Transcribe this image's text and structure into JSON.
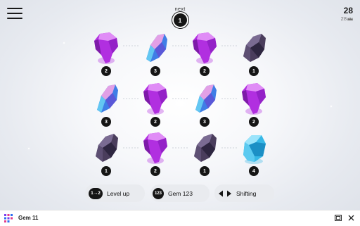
{
  "header": {
    "next_label": "next",
    "next_value": "1",
    "score": "28",
    "best": "28"
  },
  "board": {
    "rows": [
      [
        {
          "gem": "purple",
          "count": "2"
        },
        {
          "gem": "pink-blue",
          "count": "3"
        },
        {
          "gem": "purple",
          "count": "2"
        },
        {
          "gem": "dark",
          "count": "1"
        }
      ],
      [
        {
          "gem": "pink-blue",
          "count": "3"
        },
        {
          "gem": "purple",
          "count": "2"
        },
        {
          "gem": "pink-blue",
          "count": "3"
        },
        {
          "gem": "purple",
          "count": "2"
        }
      ],
      [
        {
          "gem": "dark",
          "count": "1"
        },
        {
          "gem": "purple",
          "count": "2"
        },
        {
          "gem": "dark",
          "count": "1"
        },
        {
          "gem": "cyan",
          "count": "4"
        }
      ]
    ]
  },
  "actions": [
    {
      "icon": "1→2",
      "label": "Level up"
    },
    {
      "icon": "123",
      "label": "Gem 123"
    },
    {
      "icon": "shift-arrows-icon",
      "label": "Shifting"
    }
  ],
  "footer": {
    "app_title": "Gem 11"
  },
  "colors": {
    "purple": "#b12fe0",
    "pink-blue": "#e2a0e6",
    "dark": "#4a3d5c",
    "cyan": "#38b8e6",
    "badge": "#151515"
  }
}
